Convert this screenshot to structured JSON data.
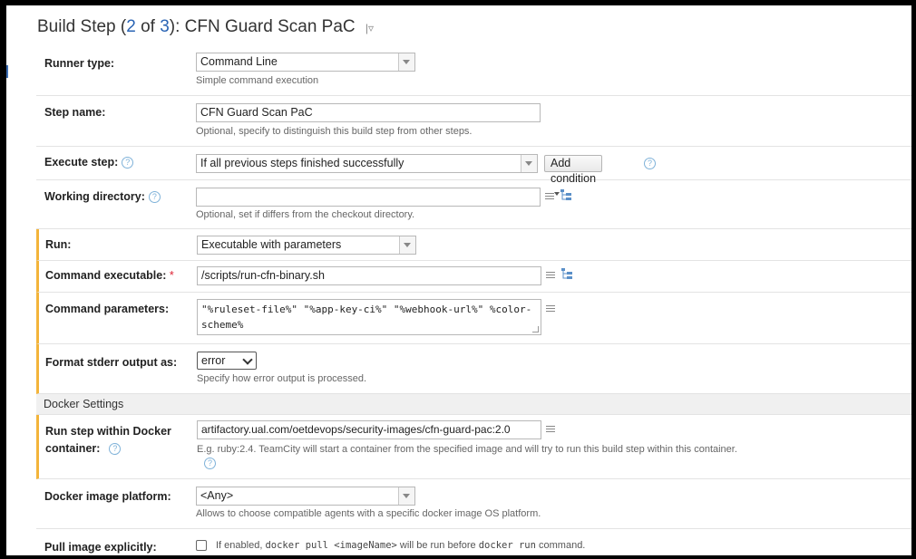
{
  "header": {
    "title_prefix": "Build Step (",
    "step_current": "2",
    "title_of": " of ",
    "step_total": "3",
    "title_suffix": "): CFN Guard Scan PaC",
    "menu_glyph": "|▿"
  },
  "runner_type": {
    "label": "Runner type:",
    "value": "Command Line",
    "note": "Simple command execution"
  },
  "step_name": {
    "label": "Step name:",
    "value": "CFN Guard Scan PaC",
    "note": "Optional, specify to distinguish this build step from other steps."
  },
  "execute_step": {
    "label": "Execute step:",
    "value": "If all previous steps finished successfully",
    "add_condition_label": "Add condition"
  },
  "working_directory": {
    "label": "Working directory:",
    "value": "",
    "note": "Optional, set if differs from the checkout directory."
  },
  "run": {
    "label": "Run:",
    "value": "Executable with parameters"
  },
  "command_executable": {
    "label": "Command executable:",
    "required_mark": "*",
    "value": "/scripts/run-cfn-binary.sh"
  },
  "command_parameters": {
    "label": "Command parameters:",
    "value": "\"%ruleset-file%\" \"%app-key-ci%\" \"%webhook-url%\" %color-scheme%"
  },
  "format_stderr": {
    "label": "Format stderr output as:",
    "value": "error",
    "note": "Specify how error output is processed."
  },
  "docker_section": {
    "title": "Docker Settings"
  },
  "docker_container": {
    "label_line1": "Run step within Docker",
    "label_line2": "container:",
    "value": "artifactory.ual.com/oetdevops/security-images/cfn-guard-pac:2.0",
    "note": "E.g. ruby:2.4. TeamCity will start a container from the specified image and will try to run this build step within this container."
  },
  "docker_platform": {
    "label": "Docker image platform:",
    "value": "<Any>",
    "note": "Allows to choose compatible agents with a specific docker image OS platform."
  },
  "pull_image": {
    "label": "Pull image explicitly:",
    "checked": false,
    "note_before": "If enabled, ",
    "note_code1": "docker pull <imageName>",
    "note_middle": " will be run before ",
    "note_code2": "docker run",
    "note_after": " command."
  },
  "colors": {
    "accent_modified": "#f3b43a",
    "link_blue": "#2a64b4",
    "help_icon": "#7fb2d9",
    "required": "#dd2233"
  }
}
